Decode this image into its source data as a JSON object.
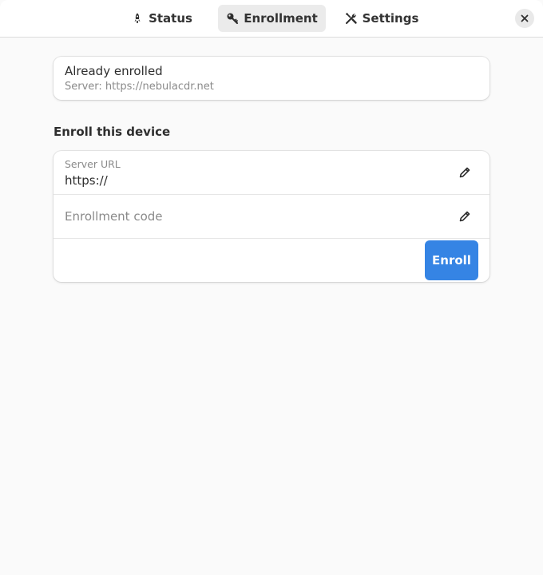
{
  "header": {
    "tabs": [
      {
        "label": "Status",
        "icon": "rocket-icon",
        "active": false
      },
      {
        "label": "Enrollment",
        "icon": "key-icon",
        "active": true
      },
      {
        "label": "Settings",
        "icon": "tools-icon",
        "active": false
      }
    ],
    "close_icon": "close-icon"
  },
  "status": {
    "title": "Already enrolled",
    "server": "Server: https://nebulacdr.net"
  },
  "enroll": {
    "section_title": "Enroll this device",
    "server_url_label": "Server URL",
    "server_url_value": "https://",
    "enrollment_code_placeholder": "Enrollment code",
    "enroll_button": "Enroll",
    "edit_icon": "pencil-icon"
  },
  "colors": {
    "accent": "#3584e4",
    "window_bg": "#fafafa",
    "card_bg": "#ffffff",
    "active_tab_bg": "#ebebeb"
  }
}
